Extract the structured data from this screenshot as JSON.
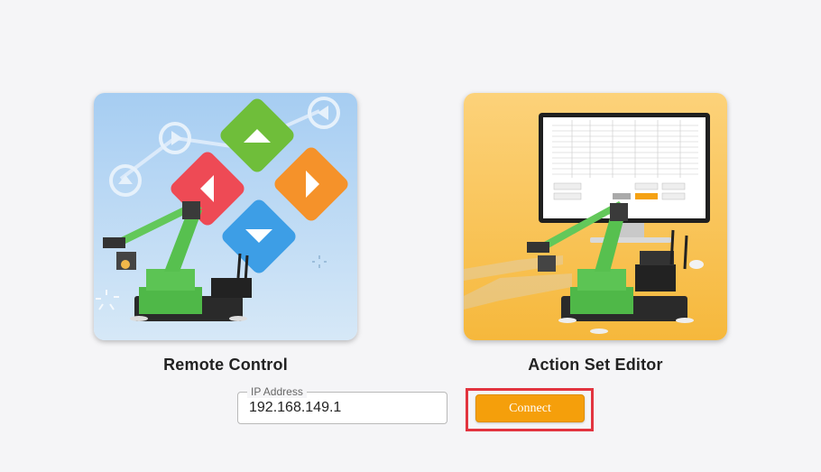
{
  "cards": [
    {
      "label": "Remote Control",
      "image_name": "remote-control-arm-illustration"
    },
    {
      "label": "Action Set Editor",
      "image_name": "action-set-editor-arm-illustration"
    }
  ],
  "connection": {
    "ip_legend": "IP Address",
    "ip_value": "192.168.149.1",
    "connect_label": "Connect"
  },
  "colors": {
    "connect_button": "#f59f0b",
    "highlight_frame": "#e2343f",
    "remote_bg": "#aad0f0",
    "editor_bg": "#f9c356",
    "arrow_up": "#6fbe3a",
    "arrow_left": "#ee4a55",
    "arrow_right": "#f5922a",
    "arrow_down": "#3d9ee6"
  }
}
